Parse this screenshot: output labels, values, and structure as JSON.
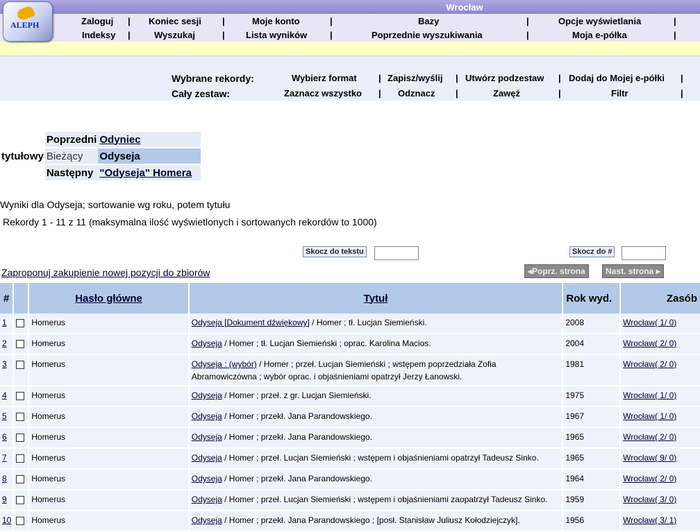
{
  "header": {
    "title": "Wrocław",
    "logo_text": "ALEPH",
    "nav_row1": [
      "Zaloguj",
      "Koniec sesji",
      "Moje konto",
      "Bazy",
      "Opcje wyświetlania"
    ],
    "nav_row2": [
      "Indeksy",
      "Wyszukaj",
      "Lista wyników",
      "Poprzednie wyszukiwania",
      "Moja e-półka"
    ]
  },
  "actions": {
    "selected_label": "Wybrane rekordy:",
    "selected": [
      "Wybierz format",
      "Zapisz/wyślij",
      "Utwórz podzestaw",
      "Dodaj do Mojej e-półki"
    ],
    "set_label": "Cały zestaw:",
    "set": [
      "Zaznacz wszystko",
      "Odznacz",
      "Zawęź",
      "Filtr"
    ]
  },
  "scan": {
    "index_label": "tytułowy",
    "prev_label": "Poprzedni",
    "prev_value": "Odyniec",
    "curr_label": "Bieżący",
    "curr_value": "Odyseja",
    "next_label": "Następny",
    "next_value": "\"Odyseja\" Homera"
  },
  "info": {
    "line1": "Wyniki dla Odyseja; sortowanie wg roku, potem tytułu",
    "line2": "Rekordy 1 - 11 z 11 (maksymalna ilość wyświetlonych i sortowanych rekordów to 1000)"
  },
  "jump": {
    "text_label": "Skocz do tekstu",
    "num_label": "Skocz do #"
  },
  "propose": "Zaproponuj zakupienie nowej pozycji do zbiorów",
  "paging": {
    "prev": "Poprz. strona",
    "next": "Nast. strona"
  },
  "table": {
    "headers": [
      "#",
      "Hasło główne",
      "Tytuł",
      "Rok wyd.",
      "Zasób"
    ],
    "rows": [
      {
        "n": "1",
        "author": "Homerus",
        "title_link": "Odyseja [Dokument dźwiękowy]",
        "title_rest": " / Homer ; tł. Lucjan Siemieński.",
        "year": "2008",
        "holdings": "Wrocław( 1/ 0)"
      },
      {
        "n": "2",
        "author": "Homerus",
        "title_link": "Odyseja",
        "title_rest": " / Homer ; tł. Lucjan Siemieński ; oprac. Karolina Macios.",
        "year": "2004",
        "holdings": "Wrocław( 2/ 0)"
      },
      {
        "n": "3",
        "author": "Homerus",
        "title_link": "Odyseja : (wybór)",
        "title_rest": " / Homer ; przeł. Lucjan Siemieński ; wstępem poprzedziała Zofia Abramowiczówna ; wybór oprac. i objaśnieniami opatrzył Jerzy Łanowski.",
        "year": "1981",
        "holdings": "Wrocław( 2/ 0)"
      },
      {
        "n": "4",
        "author": "Homerus",
        "title_link": "Odyseja",
        "title_rest": " / Homer ; przeł. z gr. Lucjan Siemieński.",
        "year": "1975",
        "holdings": "Wrocław( 1/ 0)"
      },
      {
        "n": "5",
        "author": "Homerus",
        "title_link": "Odyseja",
        "title_rest": " / Homer ; przekł. Jana Parandowskiego.",
        "year": "1967",
        "holdings": "Wrocław( 1/ 0)"
      },
      {
        "n": "6",
        "author": "Homerus",
        "title_link": "Odyseja",
        "title_rest": " / Homer ; przekł. Jana Parandowskiego.",
        "year": "1965",
        "holdings": "Wrocław( 2/ 0)"
      },
      {
        "n": "7",
        "author": "Homerus",
        "title_link": "Odyseja",
        "title_rest": " / Homer ; przeł. Lucjan Siemieński ; wstępem i objaśnieniami opatrzył Tadeusz Sinko.",
        "year": "1965",
        "holdings": "Wrocław( 9/ 0)"
      },
      {
        "n": "8",
        "author": "Homerus",
        "title_link": "Odyseja",
        "title_rest": " / Homer ; przekł. Jana Parandowskiego.",
        "year": "1964",
        "holdings": "Wrocław( 2/ 0)"
      },
      {
        "n": "9",
        "author": "Homerus",
        "title_link": "Odyseja",
        "title_rest": " / Homer ; przeł. Lucjan Siemieński ; wstępem i objaśnieniami zaopatrzył Tadeusz Sinko.",
        "year": "1959",
        "holdings": "Wrocław( 3/ 0)"
      },
      {
        "n": "10",
        "author": "Homerus",
        "title_link": "Odyseja",
        "title_rest": " / Homer ; przekł. Jana Parandowskiego ; [posł. Stanisław Juliusz Kołodziejczyk].",
        "year": "1956",
        "holdings": "Wrocław( 3/ 1)"
      }
    ]
  }
}
